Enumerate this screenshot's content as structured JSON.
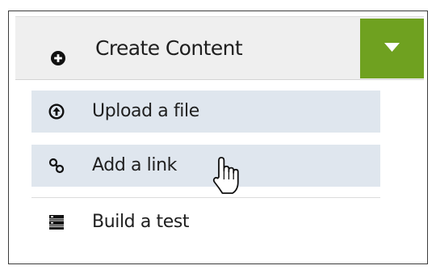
{
  "header": {
    "create_label": "Create Content",
    "plus_icon": "plus-circle-icon",
    "toggle_icon": "caret-down-icon",
    "accent_color": "#6fa120"
  },
  "menu": {
    "items": [
      {
        "label": "Upload a file",
        "icon": "upload-icon",
        "highlighted": true
      },
      {
        "label": "Add a link",
        "icon": "link-icon",
        "highlighted": true,
        "hovered": true
      },
      {
        "label": "Build a test",
        "icon": "test-list-icon",
        "highlighted": false
      }
    ],
    "highlight_color": "#dfe6ee"
  }
}
